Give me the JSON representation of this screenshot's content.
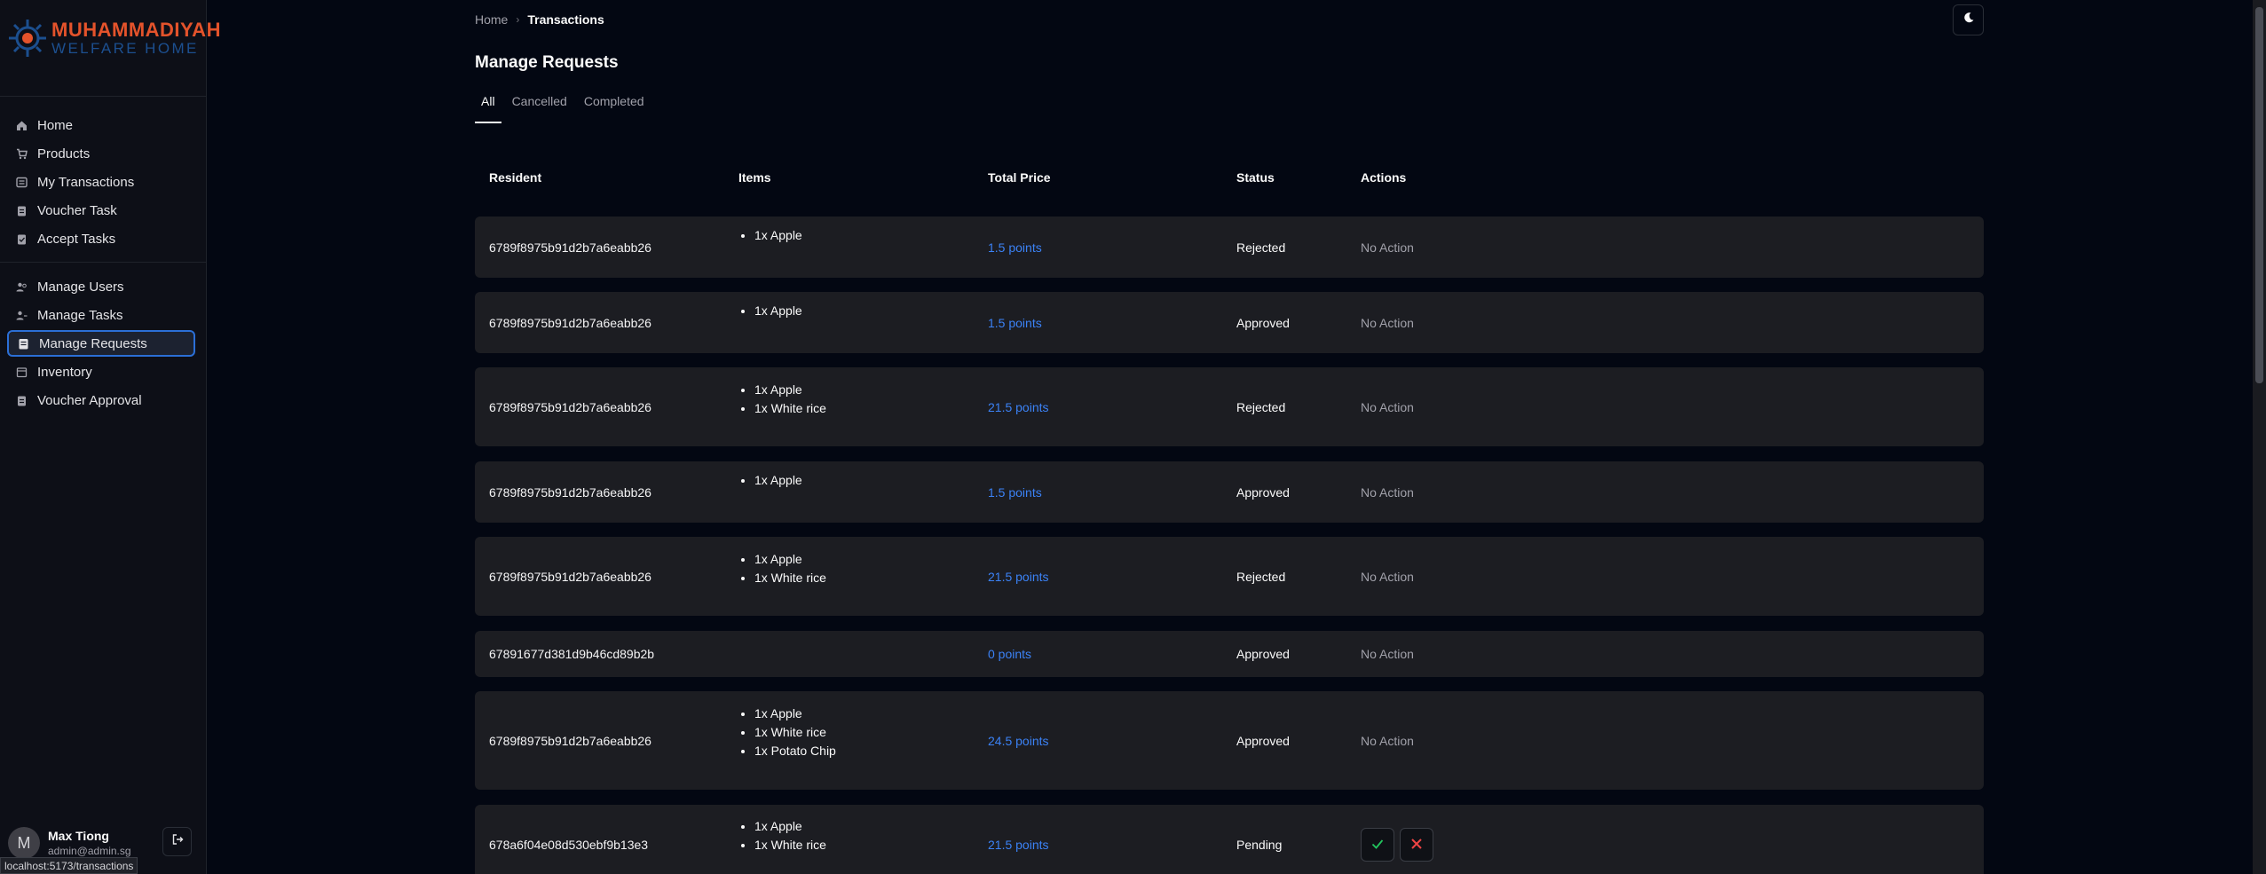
{
  "brand": {
    "line1": "MUHAMMADIYAH",
    "line2": "WELFARE HOME"
  },
  "sidebar": {
    "group1": [
      {
        "label": "Home",
        "icon": "home-icon"
      },
      {
        "label": "Products",
        "icon": "cart-icon"
      },
      {
        "label": "My Transactions",
        "icon": "transactions-icon"
      },
      {
        "label": "Voucher Task",
        "icon": "clipboard-icon"
      },
      {
        "label": "Accept Tasks",
        "icon": "clipboard-check-icon"
      }
    ],
    "group2": [
      {
        "label": "Manage Users",
        "icon": "users-icon"
      },
      {
        "label": "Manage Tasks",
        "icon": "tasks-icon"
      },
      {
        "label": "Manage Requests",
        "icon": "requests-icon",
        "active": true
      },
      {
        "label": "Inventory",
        "icon": "inventory-icon"
      },
      {
        "label": "Voucher Approval",
        "icon": "clipboard-icon"
      }
    ]
  },
  "user": {
    "initial": "M",
    "name": "Max Tiong",
    "email": "admin@admin.sg"
  },
  "status_url": "localhost:5173/transactions",
  "breadcrumb": {
    "home": "Home",
    "current": "Transactions"
  },
  "page": {
    "title": "Manage Requests"
  },
  "tabs": [
    {
      "label": "All",
      "active": true
    },
    {
      "label": "Cancelled"
    },
    {
      "label": "Completed"
    }
  ],
  "table": {
    "headers": {
      "resident": "Resident",
      "items": "Items",
      "total": "Total Price",
      "status": "Status",
      "actions": "Actions"
    },
    "rows": [
      {
        "resident": "6789f8975b91d2b7a6eabb26",
        "items": [
          "1x Apple"
        ],
        "total": "1.5 points",
        "status": "Rejected",
        "action": "No Action"
      },
      {
        "resident": "6789f8975b91d2b7a6eabb26",
        "items": [
          "1x Apple"
        ],
        "total": "1.5 points",
        "status": "Approved",
        "action": "No Action"
      },
      {
        "resident": "6789f8975b91d2b7a6eabb26",
        "items": [
          "1x Apple",
          "1x White rice"
        ],
        "total": "21.5 points",
        "status": "Rejected",
        "action": "No Action"
      },
      {
        "resident": "6789f8975b91d2b7a6eabb26",
        "items": [
          "1x Apple"
        ],
        "total": "1.5 points",
        "status": "Approved",
        "action": "No Action"
      },
      {
        "resident": "6789f8975b91d2b7a6eabb26",
        "items": [
          "1x Apple",
          "1x White rice"
        ],
        "total": "21.5 points",
        "status": "Rejected",
        "action": "No Action"
      },
      {
        "resident": "67891677d381d9b46cd89b2b",
        "items": [],
        "total": "0 points",
        "status": "Approved",
        "action": "No Action"
      },
      {
        "resident": "6789f8975b91d2b7a6eabb26",
        "items": [
          "1x Apple",
          "1x White rice",
          "1x Potato Chip"
        ],
        "total": "24.5 points",
        "status": "Approved",
        "action": "No Action"
      },
      {
        "resident": "678a6f04e08d530ebf9b13e3",
        "items": [
          "1x Apple",
          "1x White rice"
        ],
        "total": "21.5 points",
        "status": "Pending",
        "action": ""
      }
    ]
  },
  "colors": {
    "accent": "#3b82f6",
    "approve": "#22c55e",
    "reject": "#ef4444",
    "active_border": "#2b6fd6"
  }
}
